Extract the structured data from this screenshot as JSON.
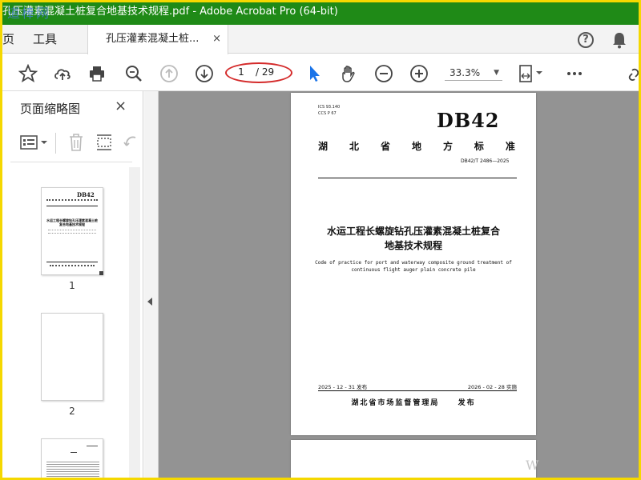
{
  "window": {
    "title": "孔压灌素混凝土桩复合地基技术规程.pdf - Adobe Acrobat Pro (64-bit)",
    "watermark": "道棒网"
  },
  "tabs": {
    "home_label": "页",
    "tools_label": "工具",
    "doc_tab_label": "孔压灌素混凝土桩...",
    "close_glyph": "×"
  },
  "toolbar": {
    "current_page": "1",
    "total_pages": "/ 29",
    "zoom": "33.3%"
  },
  "thumbnails_pane": {
    "title": "页面缩略图",
    "close_glyph": "×",
    "pages": [
      {
        "label": "1"
      },
      {
        "label": "2"
      }
    ]
  },
  "thumb1": {
    "db": "DB42",
    "title": "水运工程长螺旋钻孔压灌素混凝土桩复合地基技术规程"
  },
  "page": {
    "ics_line1": "ICS  93.140",
    "ics_line2": "CCS  P 67",
    "db": "DB42",
    "province_chars": [
      "湖",
      "北",
      "省",
      "地",
      "方",
      "标",
      "准"
    ],
    "std_code": "DB42/T 2486—2025",
    "title_line1": "水运工程长螺旋钻孔压灌素混凝土桩复合",
    "title_line2": "地基技术规程",
    "en_line1": "Code of practice for port and waterway composite ground treatment of",
    "en_line2": "continuous flight auger plain concrete pile",
    "issue_date": "2025 - 12 - 31 发布",
    "impl_date": "2026 - 02 - 28 实施",
    "issuer": "湖北省市场监督管理局",
    "issue_word": "发布"
  },
  "page2_fragment": "W",
  "colors": {
    "titlebar": "#1f8a17",
    "frame": "#f5d800",
    "annotation_oval": "#d42a2a",
    "select_tool": "#1a73e8",
    "doc_background": "#939393"
  }
}
